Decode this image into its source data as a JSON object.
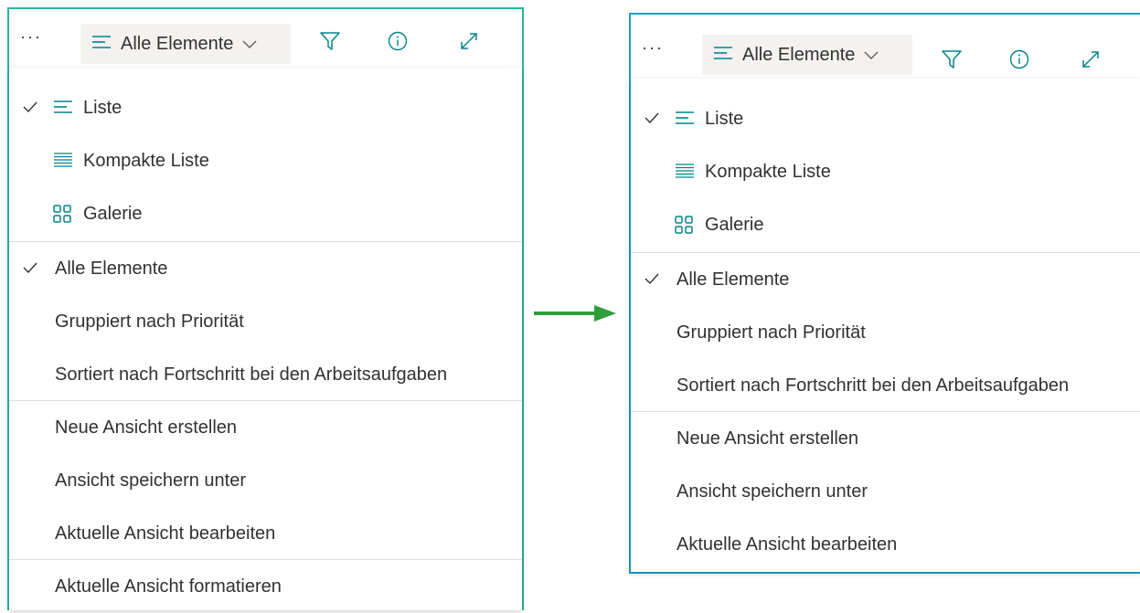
{
  "colors": {
    "accent": "#038387",
    "left_frame": "#2bb39a",
    "right_frame": "#1aa0c8",
    "arrow": "#2e9e3a",
    "text": "#323130"
  },
  "toolbar": {
    "more_label": "···",
    "view_label": "Alle Elemente",
    "icons": [
      "list-lines-icon",
      "chevron-down-icon",
      "filter-icon",
      "info-icon",
      "expand-icon"
    ]
  },
  "menu_left": {
    "layout_items": [
      {
        "label": "Liste",
        "icon": "list-icon",
        "checked": true
      },
      {
        "label": "Kompakte Liste",
        "icon": "compact-list-icon",
        "checked": false
      },
      {
        "label": "Galerie",
        "icon": "gallery-icon",
        "checked": false
      }
    ],
    "view_items": [
      {
        "label": "Alle Elemente",
        "checked": true
      },
      {
        "label": "Gruppiert nach Priorität",
        "checked": false
      },
      {
        "label": "Sortiert nach Fortschritt bei den Arbeitsaufgaben",
        "checked": false
      }
    ],
    "action_items": [
      {
        "label": "Neue Ansicht erstellen"
      },
      {
        "label": "Ansicht speichern unter"
      },
      {
        "label": "Aktuelle Ansicht bearbeiten"
      }
    ],
    "extra_items": [
      {
        "label": "Aktuelle Ansicht formatieren"
      }
    ]
  },
  "menu_right": {
    "layout_items": [
      {
        "label": "Liste",
        "icon": "list-icon",
        "checked": true
      },
      {
        "label": "Kompakte Liste",
        "icon": "compact-list-icon",
        "checked": false
      },
      {
        "label": "Galerie",
        "icon": "gallery-icon",
        "checked": false
      }
    ],
    "view_items": [
      {
        "label": "Alle Elemente",
        "checked": true
      },
      {
        "label": "Gruppiert nach Priorität",
        "checked": false
      },
      {
        "label": "Sortiert nach Fortschritt bei den Arbeitsaufgaben",
        "checked": false
      }
    ],
    "action_items": [
      {
        "label": "Neue Ansicht erstellen"
      },
      {
        "label": "Ansicht speichern unter"
      },
      {
        "label": "Aktuelle Ansicht bearbeiten"
      }
    ]
  }
}
